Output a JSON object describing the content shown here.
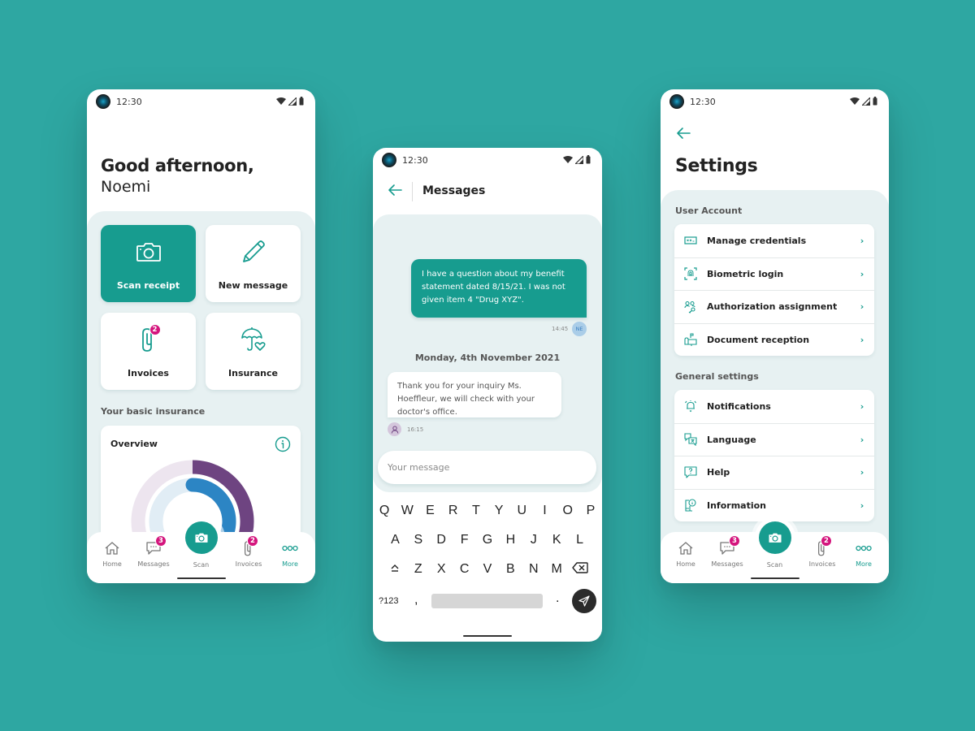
{
  "colors": {
    "background": "#2ea7a2",
    "accent": "#179c8f",
    "panel": "#e7f1f2",
    "badge": "#d4157d",
    "ring_outer": "#6e4481",
    "ring_inner": "#2c85c4"
  },
  "status_bar": {
    "time": "12:30",
    "icons": [
      "wifi-icon",
      "signal-icon",
      "battery-icon"
    ]
  },
  "home": {
    "greeting": "Good afternoon,",
    "name": "Noemi",
    "tiles": [
      {
        "label": "Scan receipt",
        "icon": "camera-icon",
        "primary": true
      },
      {
        "label": "New message",
        "icon": "pencil-icon"
      },
      {
        "label": "Invoices",
        "icon": "paperclip-icon",
        "badge": "2"
      },
      {
        "label": "Insurance",
        "icon": "umbrella-heart-icon"
      }
    ],
    "section_title": "Your basic insurance",
    "overview": {
      "title": "Overview",
      "info_icon": "info-icon",
      "outer_ring_fraction": 0.45,
      "inner_ring_fraction": 0.35
    }
  },
  "bottom_nav": {
    "items": [
      {
        "label": "Home",
        "icon": "home-icon"
      },
      {
        "label": "Messages",
        "icon": "chat-icon",
        "badge": "3"
      },
      {
        "label": "Scan",
        "icon": "camera-icon"
      },
      {
        "label": "Invoices",
        "icon": "paperclip-icon",
        "badge": "2"
      },
      {
        "label": "More",
        "icon": "more-icon",
        "active": true
      }
    ]
  },
  "messages": {
    "title": "Messages",
    "outgoing": {
      "text": "I have a question about my benefit statement dated 8/15/21. I was not given item 4 \"Drug XYZ\".",
      "time": "14:45",
      "avatar_initials": "NE"
    },
    "date_separator": "Monday, 4th November 2021",
    "incoming": {
      "text": "Thank you for your inquiry Ms. Hoeffleur, we will check with your doctor's office.",
      "time": "16:15"
    },
    "input_placeholder": "Your message",
    "keyboard": {
      "row1": [
        "Q",
        "W",
        "E",
        "R",
        "T",
        "Y",
        "U",
        "I",
        "O",
        "P"
      ],
      "row2": [
        "A",
        "S",
        "D",
        "F",
        "G",
        "H",
        "J",
        "K",
        "L"
      ],
      "row3": [
        "Z",
        "X",
        "C",
        "V",
        "B",
        "N",
        "M"
      ],
      "symbols_key": "?123",
      "comma": ",",
      "period": "."
    }
  },
  "settings": {
    "title": "Settings",
    "groups": [
      {
        "title": "User Account",
        "items": [
          {
            "label": "Manage credentials",
            "icon": "credentials-icon"
          },
          {
            "label": "Biometric login",
            "icon": "fingerprint-icon"
          },
          {
            "label": "Authorization assignment",
            "icon": "users-key-icon"
          },
          {
            "label": "Document reception",
            "icon": "mailbox-icon"
          }
        ]
      },
      {
        "title": "General settings",
        "items": [
          {
            "label": "Notifications",
            "icon": "bell-icon"
          },
          {
            "label": "Language",
            "icon": "translate-icon"
          },
          {
            "label": "Help",
            "icon": "help-icon"
          },
          {
            "label": "Information",
            "icon": "info-device-icon"
          }
        ]
      }
    ],
    "chevron": "›"
  }
}
